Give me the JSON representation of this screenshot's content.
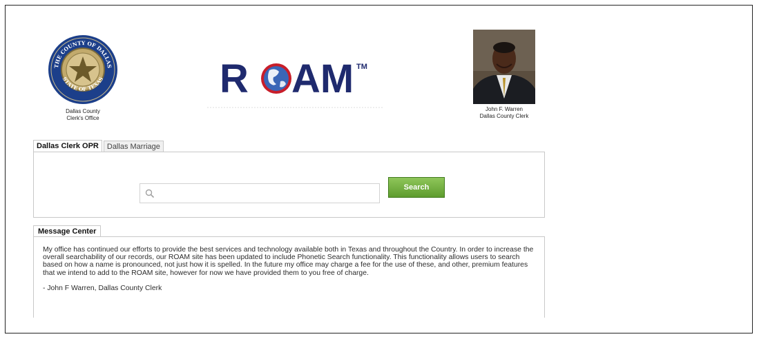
{
  "header": {
    "seal_caption_line1": "Dallas County",
    "seal_caption_line2": "Clerk's Office",
    "seal_text_top": "THE COUNTY OF DALLAS",
    "seal_text_bottom": "STATE OF TEXAS",
    "logo_text_left": "R",
    "logo_text_right": "AM",
    "logo_tm": "TM",
    "clerk_name": "John F. Warren",
    "clerk_title": "Dallas County Clerk"
  },
  "search": {
    "tabs": [
      {
        "label": "Dallas Clerk OPR",
        "active": true
      },
      {
        "label": "Dallas Marriage",
        "active": false
      }
    ],
    "input_value": "",
    "button_label": "Search"
  },
  "message_center": {
    "tab_label": "Message Center",
    "body": "My office has continued our efforts to provide the best services and technology available both in Texas and throughout the Country. In order to increase the overall searchability of our records, our ROAM site has been updated to include Phonetic Search functionality. This functionality allows users to search based on how a name is pronounced, not just how it is spelled. In the future my office may charge a fee for the use of these, and other, premium features that we intend to add to the ROAM site, however for now we have provided them to you free of charge.",
    "signature": "- John F Warren, Dallas County Clerk"
  },
  "colors": {
    "logo_navy": "#1f2a6e",
    "button_green": "#6aa83a",
    "border_gray": "#c8c8c8"
  }
}
